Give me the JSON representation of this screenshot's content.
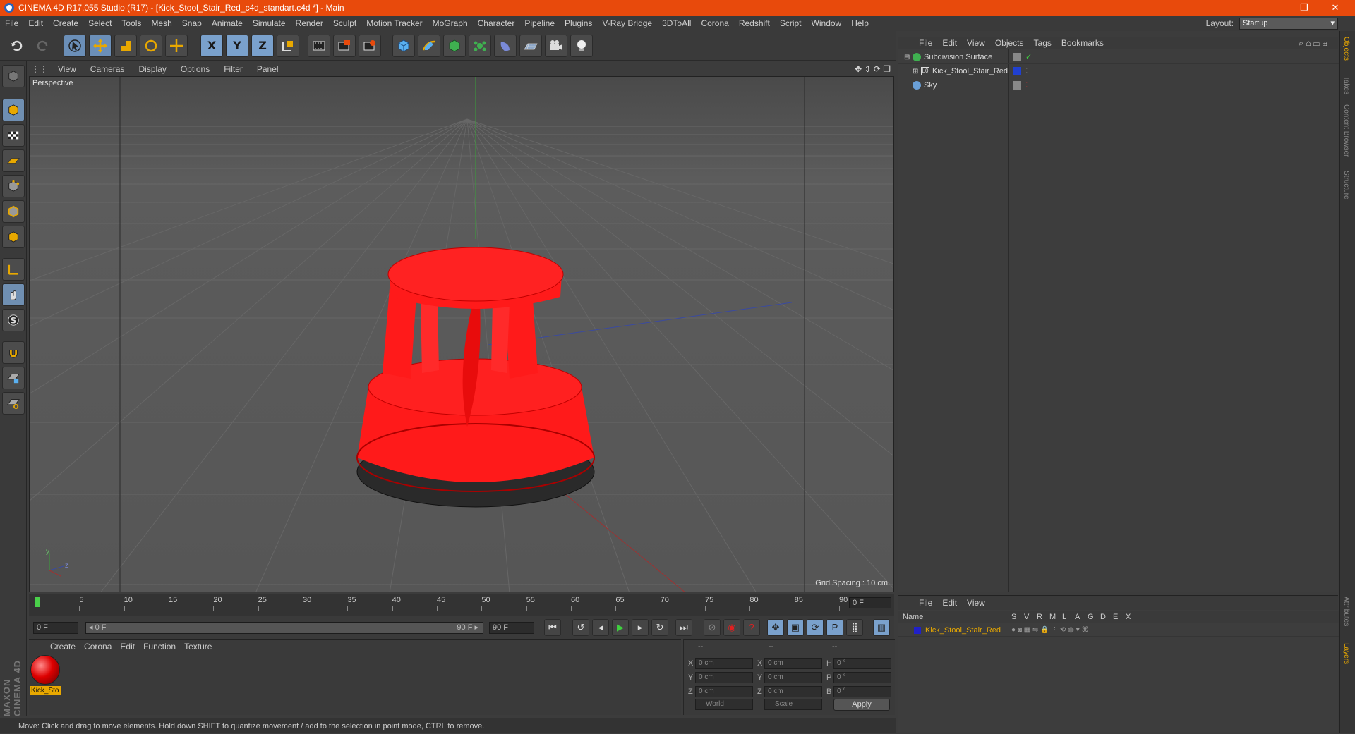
{
  "window": {
    "title": "CINEMA 4D R17.055 Studio (R17) - [Kick_Stool_Stair_Red_c4d_standart.c4d *] - Main",
    "minimize": "–",
    "maximize": "❐",
    "close": "✕"
  },
  "menubar": {
    "items": [
      "File",
      "Edit",
      "Create",
      "Select",
      "Tools",
      "Mesh",
      "Snap",
      "Animate",
      "Simulate",
      "Render",
      "Sculpt",
      "Motion Tracker",
      "MoGraph",
      "Character",
      "Pipeline",
      "Plugins",
      "V-Ray Bridge",
      "3DToAll",
      "Corona",
      "Redshift",
      "Script",
      "Window",
      "Help"
    ],
    "layout_label": "Layout:",
    "layout_value": "Startup"
  },
  "toolbar": {
    "icons": [
      "undo-icon",
      "redo-icon",
      "live-selection-icon",
      "move-icon",
      "scale-icon",
      "rotate-icon",
      "move-all-icon",
      "x-axis-icon",
      "y-axis-icon",
      "z-axis-icon",
      "world-coordinates-icon",
      "render-view-icon",
      "render-picture-viewer-icon",
      "edit-render-settings-icon",
      "cube-icon",
      "pen-icon",
      "subdivision-icon",
      "mograph-cloner-icon",
      "deformer-icon",
      "floor-icon",
      "camera-icon",
      "light-icon"
    ],
    "x_label": "X",
    "y_label": "Y",
    "z_label": "Z"
  },
  "viewport": {
    "menu": [
      "View",
      "Cameras",
      "Display",
      "Options",
      "Filter",
      "Panel"
    ],
    "label": "Perspective",
    "grid_spacing": "Grid Spacing : 10 cm",
    "axis_y": "y",
    "axis_z": "z",
    "accent_object": "#ff1a1a"
  },
  "timeline": {
    "ticks": [
      "0",
      "5",
      "10",
      "15",
      "20",
      "25",
      "30",
      "35",
      "40",
      "45",
      "50",
      "55",
      "60",
      "65",
      "70",
      "75",
      "80",
      "85",
      "90"
    ],
    "current_frame": "0 F"
  },
  "transport": {
    "start": "0 F",
    "range_start": "◂ 0 F",
    "range_end": "90 F ▸",
    "end": "90 F"
  },
  "materials": {
    "menu": [
      "Create",
      "Corona",
      "Edit",
      "Function",
      "Texture"
    ],
    "items": [
      {
        "name": "Kick_Sto"
      }
    ]
  },
  "coordinates": {
    "headers": [
      "--",
      "--",
      "--"
    ],
    "rows": [
      {
        "pos_label": "X",
        "pos": "0 cm",
        "size_label": "X",
        "size": "0 cm",
        "rot_label": "H",
        "rot": "0 °"
      },
      {
        "pos_label": "Y",
        "pos": "0 cm",
        "size_label": "Y",
        "size": "0 cm",
        "rot_label": "P",
        "rot": "0 °"
      },
      {
        "pos_label": "Z",
        "pos": "0 cm",
        "size_label": "Z",
        "size": "0 cm",
        "rot_label": "B",
        "rot": "0 °"
      }
    ],
    "world": "World",
    "scale": "Scale",
    "apply": "Apply"
  },
  "status": "Move: Click and drag to move elements. Hold down SHIFT to quantize movement / add to the selection in point mode, CTRL to remove.",
  "objects": {
    "menu": [
      "File",
      "Edit",
      "View",
      "Objects",
      "Tags",
      "Bookmarks"
    ],
    "rows": [
      {
        "name": "Subdivision Surface",
        "icon": "subdivision-icon",
        "color": "#3fb050"
      },
      {
        "name": "Kick_Stool_Stair_Red",
        "icon": "polygon-object-icon",
        "color": "#2040d0"
      },
      {
        "name": "Sky",
        "icon": "sky-icon",
        "color": "#6aa0d8"
      }
    ]
  },
  "layers": {
    "menu": [
      "File",
      "Edit",
      "View"
    ],
    "header_name": "Name",
    "header_cols": [
      "S",
      "V",
      "R",
      "M",
      "L",
      "A",
      "G",
      "D",
      "E",
      "X"
    ],
    "rows": [
      {
        "name": "Kick_Stool_Stair_Red",
        "color": "#2020c8"
      }
    ]
  },
  "sidetabs": {
    "upper": [
      "Objects",
      "Takes",
      "Content Browser",
      "Structure"
    ],
    "lower": [
      "Attributes",
      "Layers"
    ]
  },
  "brand": "MAXON CINEMA 4D"
}
